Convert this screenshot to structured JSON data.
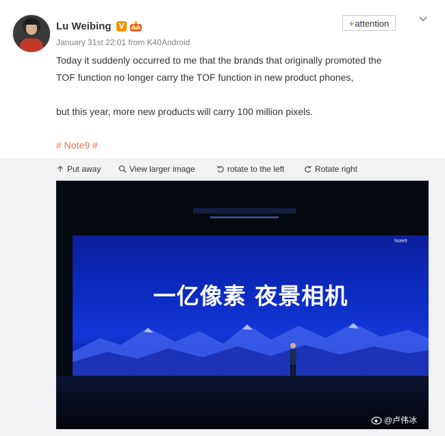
{
  "post": {
    "username": "Lu Weibing",
    "verified_badge": "V",
    "meta": "January 31st 22:01 from K40Android",
    "follow_label": "attention",
    "follow_plus": "+",
    "paragraph_1": "Today it suddenly occurred to me that the brands that originally promoted the",
    "paragraph_2": "TOF function no longer carry the TOF function in new product phones,",
    "paragraph_3": "but this year, more new products will carry 100 million pixels.",
    "hashtag": "# Note9 #"
  },
  "image_toolbar": {
    "put_away": "Put away",
    "view_larger": "View larger image",
    "rotate_left": "rotate to the left",
    "rotate_right": "Rotate right"
  },
  "photo": {
    "headline": "一亿像素 夜景相机",
    "corner_label": "Note9",
    "watermark": "@卢伟冰"
  },
  "colors": {
    "accent_orange": "#ff8200",
    "hashtag": "#eb7350",
    "verified": "#f29100",
    "toolbar_bg": "#f2f2f5"
  },
  "icons": [
    "avatar",
    "verified-v-icon",
    "crown-icon",
    "chevron-down-icon",
    "put-away-icon",
    "magnifier-icon",
    "rotate-left-icon",
    "rotate-right-icon",
    "weibo-eye-icon"
  ]
}
